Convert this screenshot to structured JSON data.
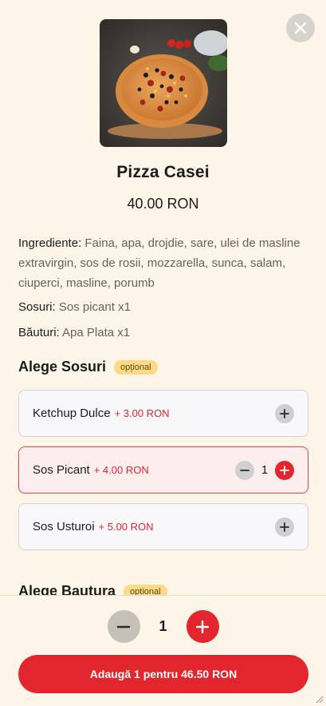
{
  "product": {
    "name": "Pizza Casei",
    "price": "40.00 RON",
    "ingredients_label": "Ingrediente:",
    "ingredients_value": "Faina, apa, drojdie, sare, ulei de masline extravirgin, sos de rosii, mozzarella, sunca, salam, ciuperci, masline, porumb",
    "sauces_label": "Sosuri:",
    "sauces_value": "Sos picant x1",
    "drinks_label": "Băuturi:",
    "drinks_value": "Apa Plata x1"
  },
  "sauces_section": {
    "title": "Alege Sosuri",
    "badge": "opțional",
    "options": [
      {
        "name": "Ketchup Dulce",
        "price": "+ 3.00 RON",
        "selected": false
      },
      {
        "name": "Sos Picant",
        "price": "+ 4.00 RON",
        "selected": true,
        "quantity": "1"
      },
      {
        "name": "Sos Usturoi",
        "price": "+ 5.00 RON",
        "selected": false
      }
    ]
  },
  "drinks_section": {
    "title": "Alege Bautura",
    "badge": "optional"
  },
  "footer": {
    "quantity": "1",
    "add_label": "Adaugă 1 pentru 46.50 RON"
  },
  "colors": {
    "background": "#fdf5e8",
    "accent": "#e3262d",
    "badge": "#fbd985"
  },
  "icons": {
    "close": "close-icon",
    "plus": "plus-icon",
    "minus": "minus-icon"
  }
}
